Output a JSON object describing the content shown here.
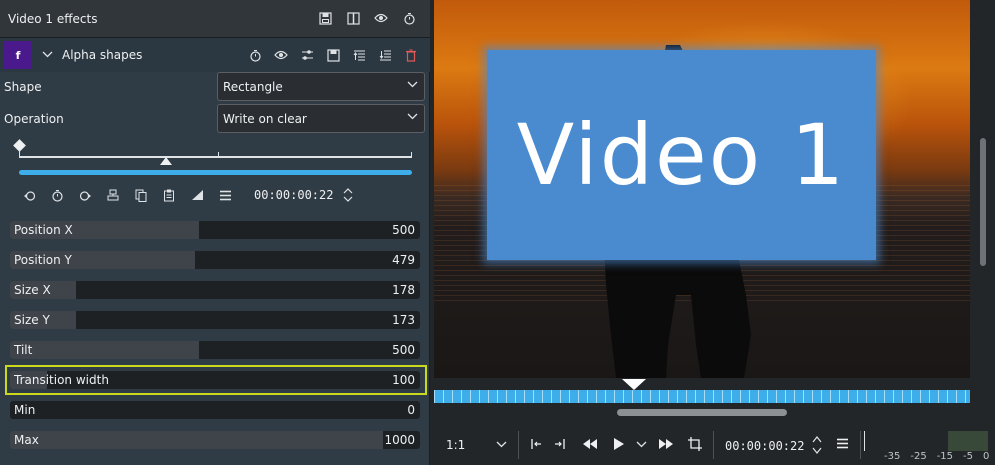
{
  "panel": {
    "title": "Video 1 effects",
    "header_icons": [
      "save-icon",
      "split-compare-icon",
      "eye-icon",
      "timer-icon"
    ]
  },
  "effect": {
    "badge": "f",
    "name": "Alpha shapes",
    "icons": [
      "timer-icon",
      "eye-icon",
      "sliders-icon",
      "save-icon",
      "align-top-icon",
      "align-bottom-icon",
      "delete-icon"
    ]
  },
  "fields": {
    "shape": {
      "label": "Shape",
      "value": "Rectangle"
    },
    "operation": {
      "label": "Operation",
      "value": "Write on clear"
    }
  },
  "keyframes": {
    "timecode": "00:00:00:22",
    "tools": [
      "previous-keyframe-icon",
      "add-keyframe-icon",
      "next-keyframe-icon",
      "align-icon",
      "copy-icon",
      "paste-icon",
      "curve-icon",
      "menu-icon"
    ]
  },
  "params": [
    {
      "label": "Position X",
      "value": "500",
      "fill": 0.46
    },
    {
      "label": "Position Y",
      "value": "479",
      "fill": 0.45
    },
    {
      "label": "Size X",
      "value": "178",
      "fill": 0.16
    },
    {
      "label": "Size Y",
      "value": "173",
      "fill": 0.16
    },
    {
      "label": "Tilt",
      "value": "500",
      "fill": 0.46
    },
    {
      "label": "Transition width",
      "value": "100",
      "fill": 0.09
    },
    {
      "label": "Min",
      "value": "0",
      "fill": 0.0
    },
    {
      "label": "Max",
      "value": "1000",
      "fill": 0.91
    }
  ],
  "monitor": {
    "overlay_text": "Video 1",
    "zoom": "1:1",
    "timecode": "00:00:00:22",
    "meter_scale": [
      "-35",
      "-25",
      "-15",
      "-5",
      "0"
    ]
  },
  "colors": {
    "accent": "#3daee9",
    "highlight": "#c8d91e",
    "overlay": "#4a8bd0",
    "effect_badge": "#4a1a8c",
    "delete": "#e05a5a"
  }
}
